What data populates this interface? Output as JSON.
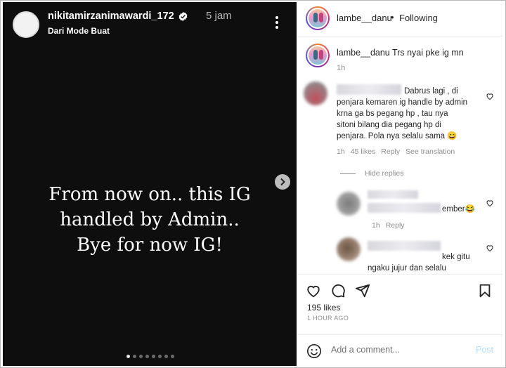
{
  "story": {
    "username": "nikitamirzanimawardi_172",
    "time": "5 jam",
    "subtitle": "Dari Mode Buat",
    "text_lines": [
      "From now on.. this IG",
      "handled by Admin..",
      "Bye for now IG!"
    ],
    "progress_dots": 8,
    "active_dot": 0
  },
  "post": {
    "header": {
      "username": "lambe__danu",
      "separator": "•",
      "follow_status": "Following"
    },
    "caption": {
      "username": "lambe__danu",
      "text": "Trs nyai pke ig mn",
      "time": "1h"
    },
    "comments": [
      {
        "lines": [
          "Dabrus lagi , di",
          "penjara kemaren ig handle by admin",
          "krna ga bs pegang hp , tau nya",
          "sitoni bilang dia pegang hp di",
          "penjara. Pola nya selalu sama 😄"
        ],
        "time": "1h",
        "likes": "45 likes",
        "reply_label": "Reply",
        "translation_label": "See translation"
      }
    ],
    "hide_replies_label": "Hide replies",
    "replies": [
      {
        "text": "ember😂",
        "time": "1h",
        "reply_label": "Reply"
      },
      {
        "lines": [
          "kek gitu",
          "ngaku jujur dan selalu"
        ]
      }
    ],
    "likes": "195 likes",
    "posted_ago": "1 HOUR AGO",
    "add_comment_placeholder": "Add a comment...",
    "post_label": "Post"
  }
}
